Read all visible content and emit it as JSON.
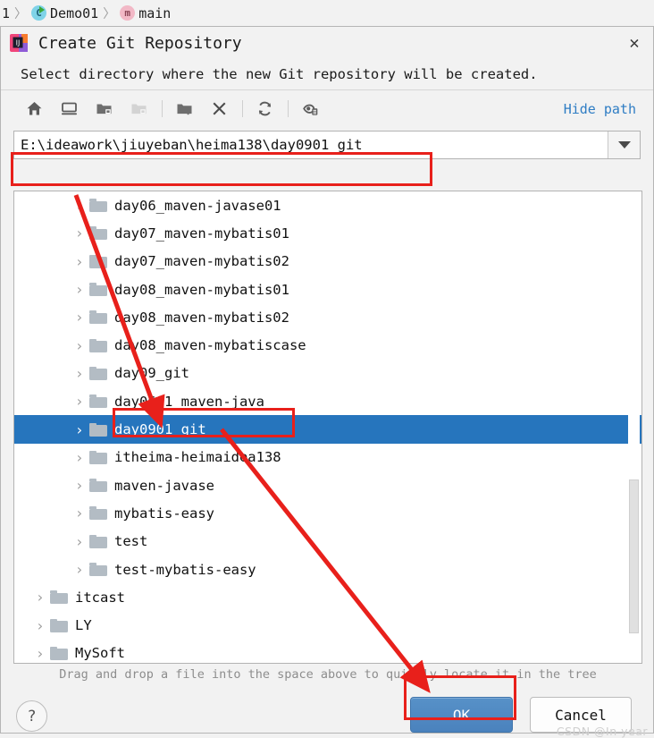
{
  "ide_breadcrumb": {
    "items": [
      {
        "label": "1",
        "icon": "truncated-crumb-icon"
      },
      {
        "label": "Demo01",
        "icon": "class-icon"
      },
      {
        "label": "main",
        "icon": "method-icon"
      }
    ],
    "separator": "〉"
  },
  "dialog": {
    "icon": "intellij-idea-icon",
    "title": "Create Git Repository",
    "close_label": "✕",
    "subtitle": "Select directory where the new Git repository will be created."
  },
  "toolbar": {
    "buttons": [
      {
        "name": "home-icon",
        "tooltip": "Home"
      },
      {
        "name": "desktop-icon",
        "tooltip": "Desktop"
      },
      {
        "name": "project-folder-icon",
        "tooltip": "Project Directory"
      },
      {
        "name": "module-folder-icon",
        "tooltip": "Module Directory",
        "disabled": true
      },
      {
        "name": "new-folder-icon",
        "tooltip": "New Folder"
      },
      {
        "name": "delete-icon",
        "tooltip": "Delete"
      },
      {
        "name": "refresh-icon",
        "tooltip": "Refresh"
      },
      {
        "name": "show-hidden-files-icon",
        "tooltip": "Show Hidden Files"
      }
    ],
    "hide_path_label": "Hide path"
  },
  "path_field": {
    "value": "E:\\ideawork\\jiuyeban\\heima138\\day0901_git",
    "placeholder": "",
    "dropdown_icon": "chevron-down-icon"
  },
  "tree": {
    "rows": [
      {
        "label": "day06_maven-javase01",
        "depth": 2,
        "selected": false,
        "expandable": true
      },
      {
        "label": "day07_maven-mybatis01",
        "depth": 2,
        "selected": false,
        "expandable": true
      },
      {
        "label": "day07_maven-mybatis02",
        "depth": 2,
        "selected": false,
        "expandable": true
      },
      {
        "label": "day08_maven-mybatis01",
        "depth": 2,
        "selected": false,
        "expandable": true
      },
      {
        "label": "day08_maven-mybatis02",
        "depth": 2,
        "selected": false,
        "expandable": true
      },
      {
        "label": "day08_maven-mybatiscase",
        "depth": 2,
        "selected": false,
        "expandable": true
      },
      {
        "label": "day09_git",
        "depth": 2,
        "selected": false,
        "expandable": true
      },
      {
        "label": "day0601_maven-java",
        "depth": 2,
        "selected": false,
        "expandable": true
      },
      {
        "label": "day0901_git",
        "depth": 2,
        "selected": true,
        "expandable": true
      },
      {
        "label": "itheima-heimaidea138",
        "depth": 2,
        "selected": false,
        "expandable": true
      },
      {
        "label": "maven-javase",
        "depth": 2,
        "selected": false,
        "expandable": true
      },
      {
        "label": "mybatis-easy",
        "depth": 2,
        "selected": false,
        "expandable": true
      },
      {
        "label": "test",
        "depth": 2,
        "selected": false,
        "expandable": true
      },
      {
        "label": "test-mybatis-easy",
        "depth": 2,
        "selected": false,
        "expandable": true
      },
      {
        "label": "itcast",
        "depth": 1,
        "selected": false,
        "expandable": true
      },
      {
        "label": "LY",
        "depth": 1,
        "selected": false,
        "expandable": true
      },
      {
        "label": "MySoft",
        "depth": 1,
        "selected": false,
        "expandable": true
      }
    ],
    "expander_glyph": "›",
    "folder_icon": "folder-icon",
    "selection_color": "#2675bd"
  },
  "drag_hint": "Drag and drop a file into the space above to quickly locate it in the tree",
  "footer": {
    "help_label": "?",
    "ok_label": "OK",
    "cancel_label": "Cancel"
  },
  "watermark": "CSDN @In year",
  "annotations": {
    "accent_color": "#e8201b",
    "boxes": [
      {
        "name": "path-field-highlight"
      },
      {
        "name": "selected-folder-highlight"
      },
      {
        "name": "ok-button-highlight"
      }
    ],
    "arrows": [
      {
        "name": "arrow-path-to-folder"
      },
      {
        "name": "arrow-folder-to-ok"
      }
    ]
  }
}
